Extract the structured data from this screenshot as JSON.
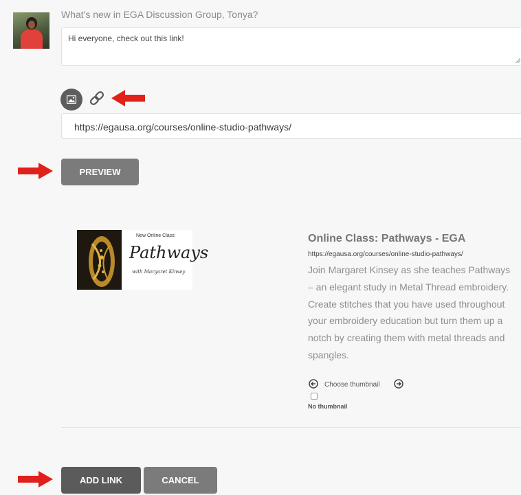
{
  "composer": {
    "prompt": "What's new in EGA Discussion Group, Tonya?",
    "message": "Hi everyone, check out this link!",
    "link_url": "https://egausa.org/courses/online-studio-pathways/"
  },
  "buttons": {
    "preview": "PREVIEW",
    "add_link": "ADD LINK",
    "cancel": "CANCEL"
  },
  "thumbnail": {
    "small_text": "New Online Class:",
    "big_text": "Pathways",
    "byline": "with Margaret Kinsey"
  },
  "link_preview": {
    "title": "Online Class: Pathways - EGA",
    "url": "https://egausa.org/courses/online-studio-pathways/",
    "description": "Join Margaret Kinsey as she teaches Pathways – an elegant study in Metal Thread embroidery. Create stitches that you have used throughout your embroidery education but turn them up a notch by creating them with metal threads and spangles.",
    "choose_thumbnail": "Choose thumbnail",
    "no_thumbnail": "No thumbnail"
  },
  "colors": {
    "annotation_arrow": "#e0201b",
    "button_gray": "#7b7b7b",
    "button_dark": "#5b5b5b"
  },
  "icons": [
    "image-icon",
    "link-icon",
    "arrow-left-circle-icon",
    "arrow-right-circle-icon"
  ]
}
